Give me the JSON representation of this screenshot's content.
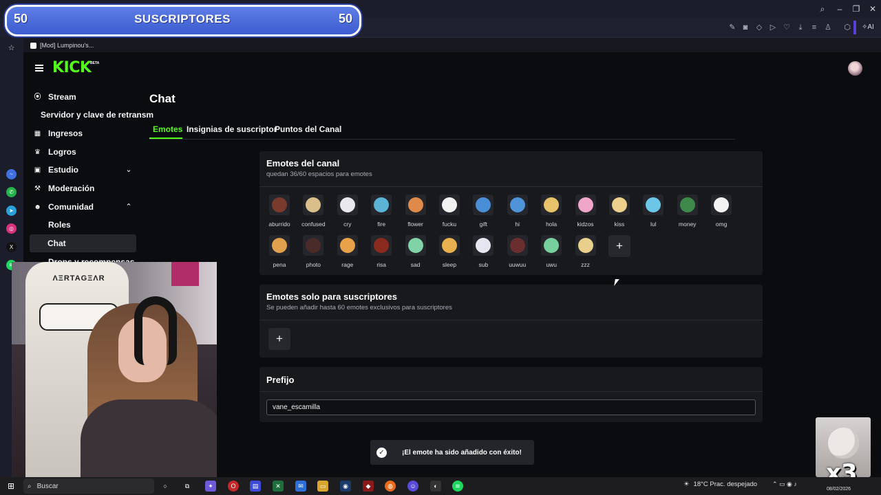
{
  "banner": {
    "left_count": "50",
    "text": "SUSCRIPTORES",
    "right_count": "50"
  },
  "browser": {
    "tab_title": "[Mod] Lumpinou's...",
    "ai_label": "AI"
  },
  "kick": {
    "logo": "KICK",
    "logo_badge": "BETA",
    "nav": {
      "stream": "Stream",
      "stream_sub": "Servidor y clave de retransm",
      "ingresos": "Ingresos",
      "logros": "Logros",
      "estudio": "Estudio",
      "moderacion": "Moderación",
      "comunidad": "Comunidad",
      "roles": "Roles",
      "chat": "Chat",
      "drops": "Drops y recompensas"
    },
    "page_title": "Chat",
    "tabs": [
      "Emotes",
      "Insignias de suscriptor",
      "Puntos del Canal"
    ],
    "channel_emotes": {
      "title": "Emotes del canal",
      "subtitle": "quedan 36/60 espacios para emotes",
      "row1": [
        {
          "name": "aburrido",
          "color": "#7a3b2c"
        },
        {
          "name": "confused",
          "color": "#d9c08a"
        },
        {
          "name": "cry",
          "color": "#e8e8ee"
        },
        {
          "name": "fire",
          "color": "#5bb3d6"
        },
        {
          "name": "flower",
          "color": "#e08a4a"
        },
        {
          "name": "fucku",
          "color": "#f2f2f2"
        },
        {
          "name": "gift",
          "color": "#4a8ed8"
        },
        {
          "name": "hi",
          "color": "#4f93d8"
        },
        {
          "name": "hola",
          "color": "#e6c36a"
        },
        {
          "name": "kidzos",
          "color": "#f0a6c8"
        },
        {
          "name": "kiss",
          "color": "#ecd08c"
        },
        {
          "name": "lul",
          "color": "#6cc6e8"
        },
        {
          "name": "money",
          "color": "#3d8a4a"
        },
        {
          "name": "omg",
          "color": "#f3f3f3"
        }
      ],
      "row2": [
        {
          "name": "pena",
          "color": "#e0a04e"
        },
        {
          "name": "photo",
          "color": "#4b2a2a"
        },
        {
          "name": "rage",
          "color": "#e8a24a"
        },
        {
          "name": "risa",
          "color": "#8a2a1e"
        },
        {
          "name": "sad",
          "color": "#7fd3a6"
        },
        {
          "name": "sleep",
          "color": "#e8b04e"
        },
        {
          "name": "sub",
          "color": "#e6e6f0"
        },
        {
          "name": "uuwuu",
          "color": "#6a2e2e"
        },
        {
          "name": "uwu",
          "color": "#78cf9e"
        },
        {
          "name": "zzz",
          "color": "#e8d08c"
        }
      ],
      "add_label": "+"
    },
    "sub_emotes": {
      "title": "Emotes solo para suscriptores",
      "subtitle": "Se pueden añadir hasta 60 emotes exclusivos para suscriptores",
      "add_label": "+"
    },
    "prefix": {
      "title": "Prefijo",
      "value": "vane_escamilla"
    },
    "toast": "¡El emote ha sido añadido con éxito!"
  },
  "webcam": {
    "chair_text": "ΛΞRTAGΞΛR"
  },
  "meme_overlay": {
    "multiplier": "x3"
  },
  "taskbar": {
    "search": "Buscar",
    "weather": "18°C  Prac. despejado",
    "date": "08/02/2026"
  },
  "colors": {
    "kick_green": "#53fc18",
    "card_bg": "#18191d",
    "page_bg": "#0b0c10"
  }
}
